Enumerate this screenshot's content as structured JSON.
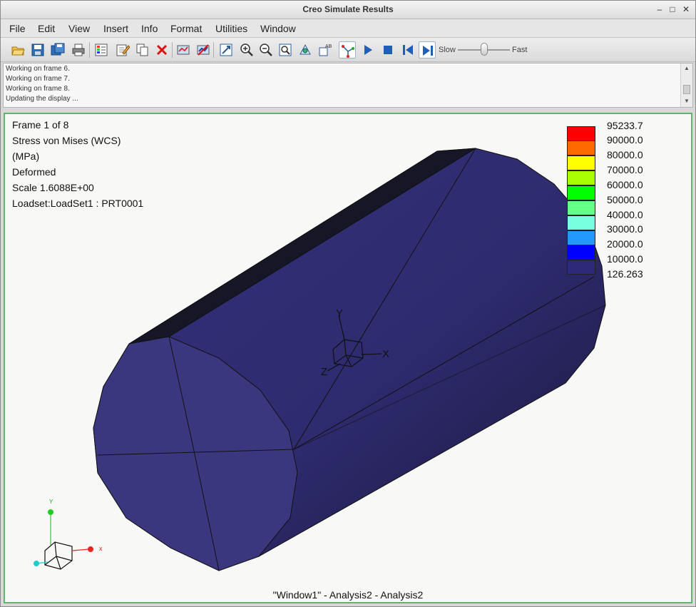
{
  "window": {
    "title": "Creo Simulate Results"
  },
  "menu": [
    "File",
    "Edit",
    "View",
    "Insert",
    "Info",
    "Format",
    "Utilities",
    "Window"
  ],
  "toolbar": {
    "slow_label": "Slow",
    "fast_label": "Fast",
    "speed_value": 0.5
  },
  "messages": [
    "Working on frame 6.",
    "Working on frame 7.",
    "Working on frame 8.",
    "Updating the display ..."
  ],
  "info": {
    "frame": "Frame 1 of 8",
    "quantity": "Stress von Mises (WCS)",
    "units": "(MPa)",
    "mode": "Deformed",
    "scale": "Scale  1.6088E+00",
    "loadset": "Loadset:LoadSet1 :  PRT0001"
  },
  "legend": {
    "max": "95233.7",
    "min": "126.263",
    "levels": [
      "90000.0",
      "80000.0",
      "70000.0",
      "60000.0",
      "50000.0",
      "40000.0",
      "30000.0",
      "20000.0",
      "10000.0"
    ],
    "colors": [
      "#ff0000",
      "#ff6a00",
      "#ffff00",
      "#aaff00",
      "#00ff00",
      "#66ff88",
      "#77ffe0",
      "#2299ff",
      "#0000ff",
      "#2c2a78"
    ]
  },
  "triad": {
    "x": "X",
    "y": "Y",
    "z": "Z"
  },
  "mini_triad": {
    "x": "x",
    "y": "Y"
  },
  "footer": "\"Window1\" - Analysis2 - Analysis2"
}
